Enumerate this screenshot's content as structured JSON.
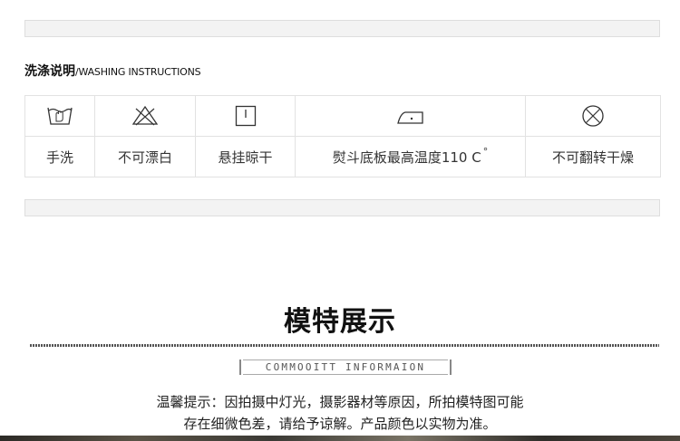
{
  "washing": {
    "title_cn": "洗涤说明",
    "title_sep": "/",
    "title_en": "WASHING INSTRUCTIONS",
    "items": [
      {
        "icon": "hand-wash-icon",
        "label": "手洗"
      },
      {
        "icon": "no-bleach-icon",
        "label": "不可漂白"
      },
      {
        "icon": "hang-dry-icon",
        "label": "悬挂晾干"
      },
      {
        "icon": "iron-icon",
        "label": "熨斗底板最高温度110 C",
        "superscript": "°"
      },
      {
        "icon": "no-tumble-dry-icon",
        "label": "不可翻转干燥"
      }
    ]
  },
  "model": {
    "title": "模特展示",
    "subtitle": "COMMOOITT INFORMAION"
  },
  "notice": {
    "line1": "温馨提示：因拍摄中灯光，摄影器材等原因，所拍模特图可能",
    "line2": "存在细微色差，请给予谅解。产品颜色以实物为准。"
  }
}
